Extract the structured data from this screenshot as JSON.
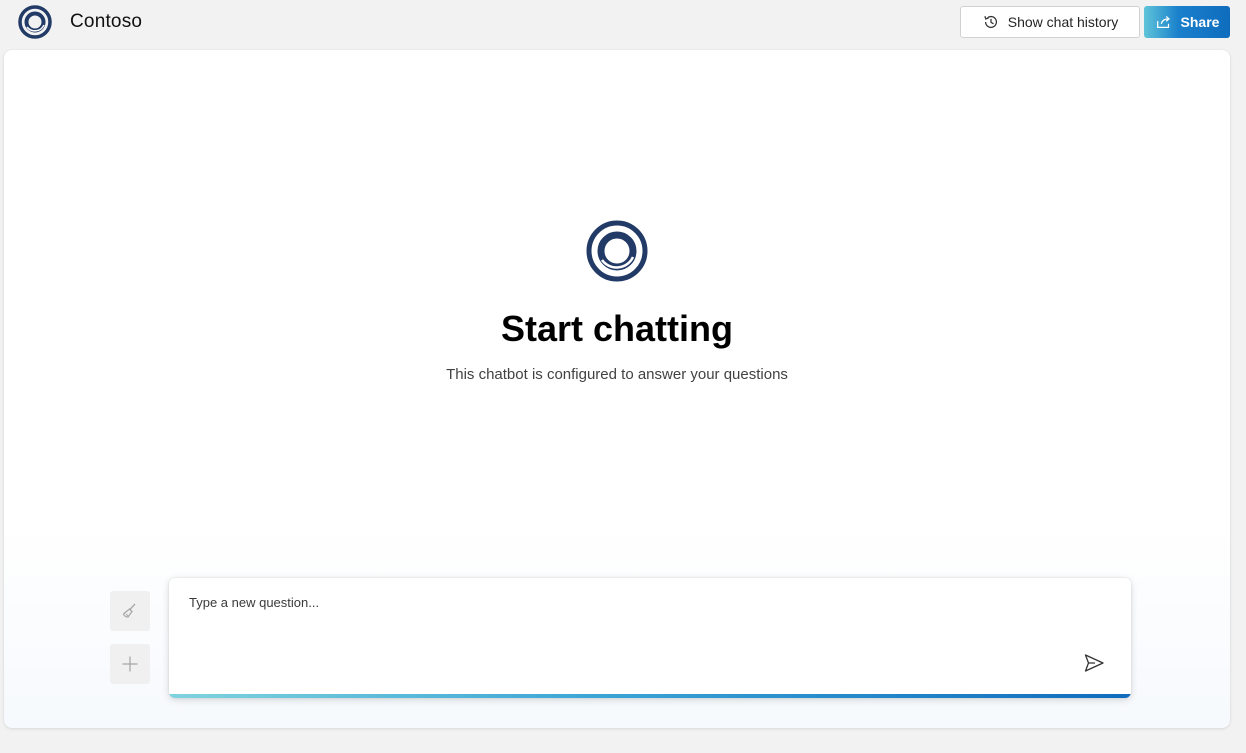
{
  "header": {
    "app_title": "Contoso",
    "history_button_label": "Show chat history",
    "share_button_label": "Share",
    "logo_icon": "contoso-ring-logo"
  },
  "empty_state": {
    "title": "Start chatting",
    "subtitle": "This chatbot is configured to answer your questions",
    "logo_icon": "contoso-ring-logo"
  },
  "composer": {
    "placeholder": "Type a new question...",
    "value": "",
    "clear_icon": "broom-icon",
    "new_chat_icon": "plus-icon",
    "send_icon": "send-icon"
  },
  "colors": {
    "logo_navy": "#223a66",
    "share_accent": "#0f6cbd",
    "page_background": "#f2f2f2"
  }
}
